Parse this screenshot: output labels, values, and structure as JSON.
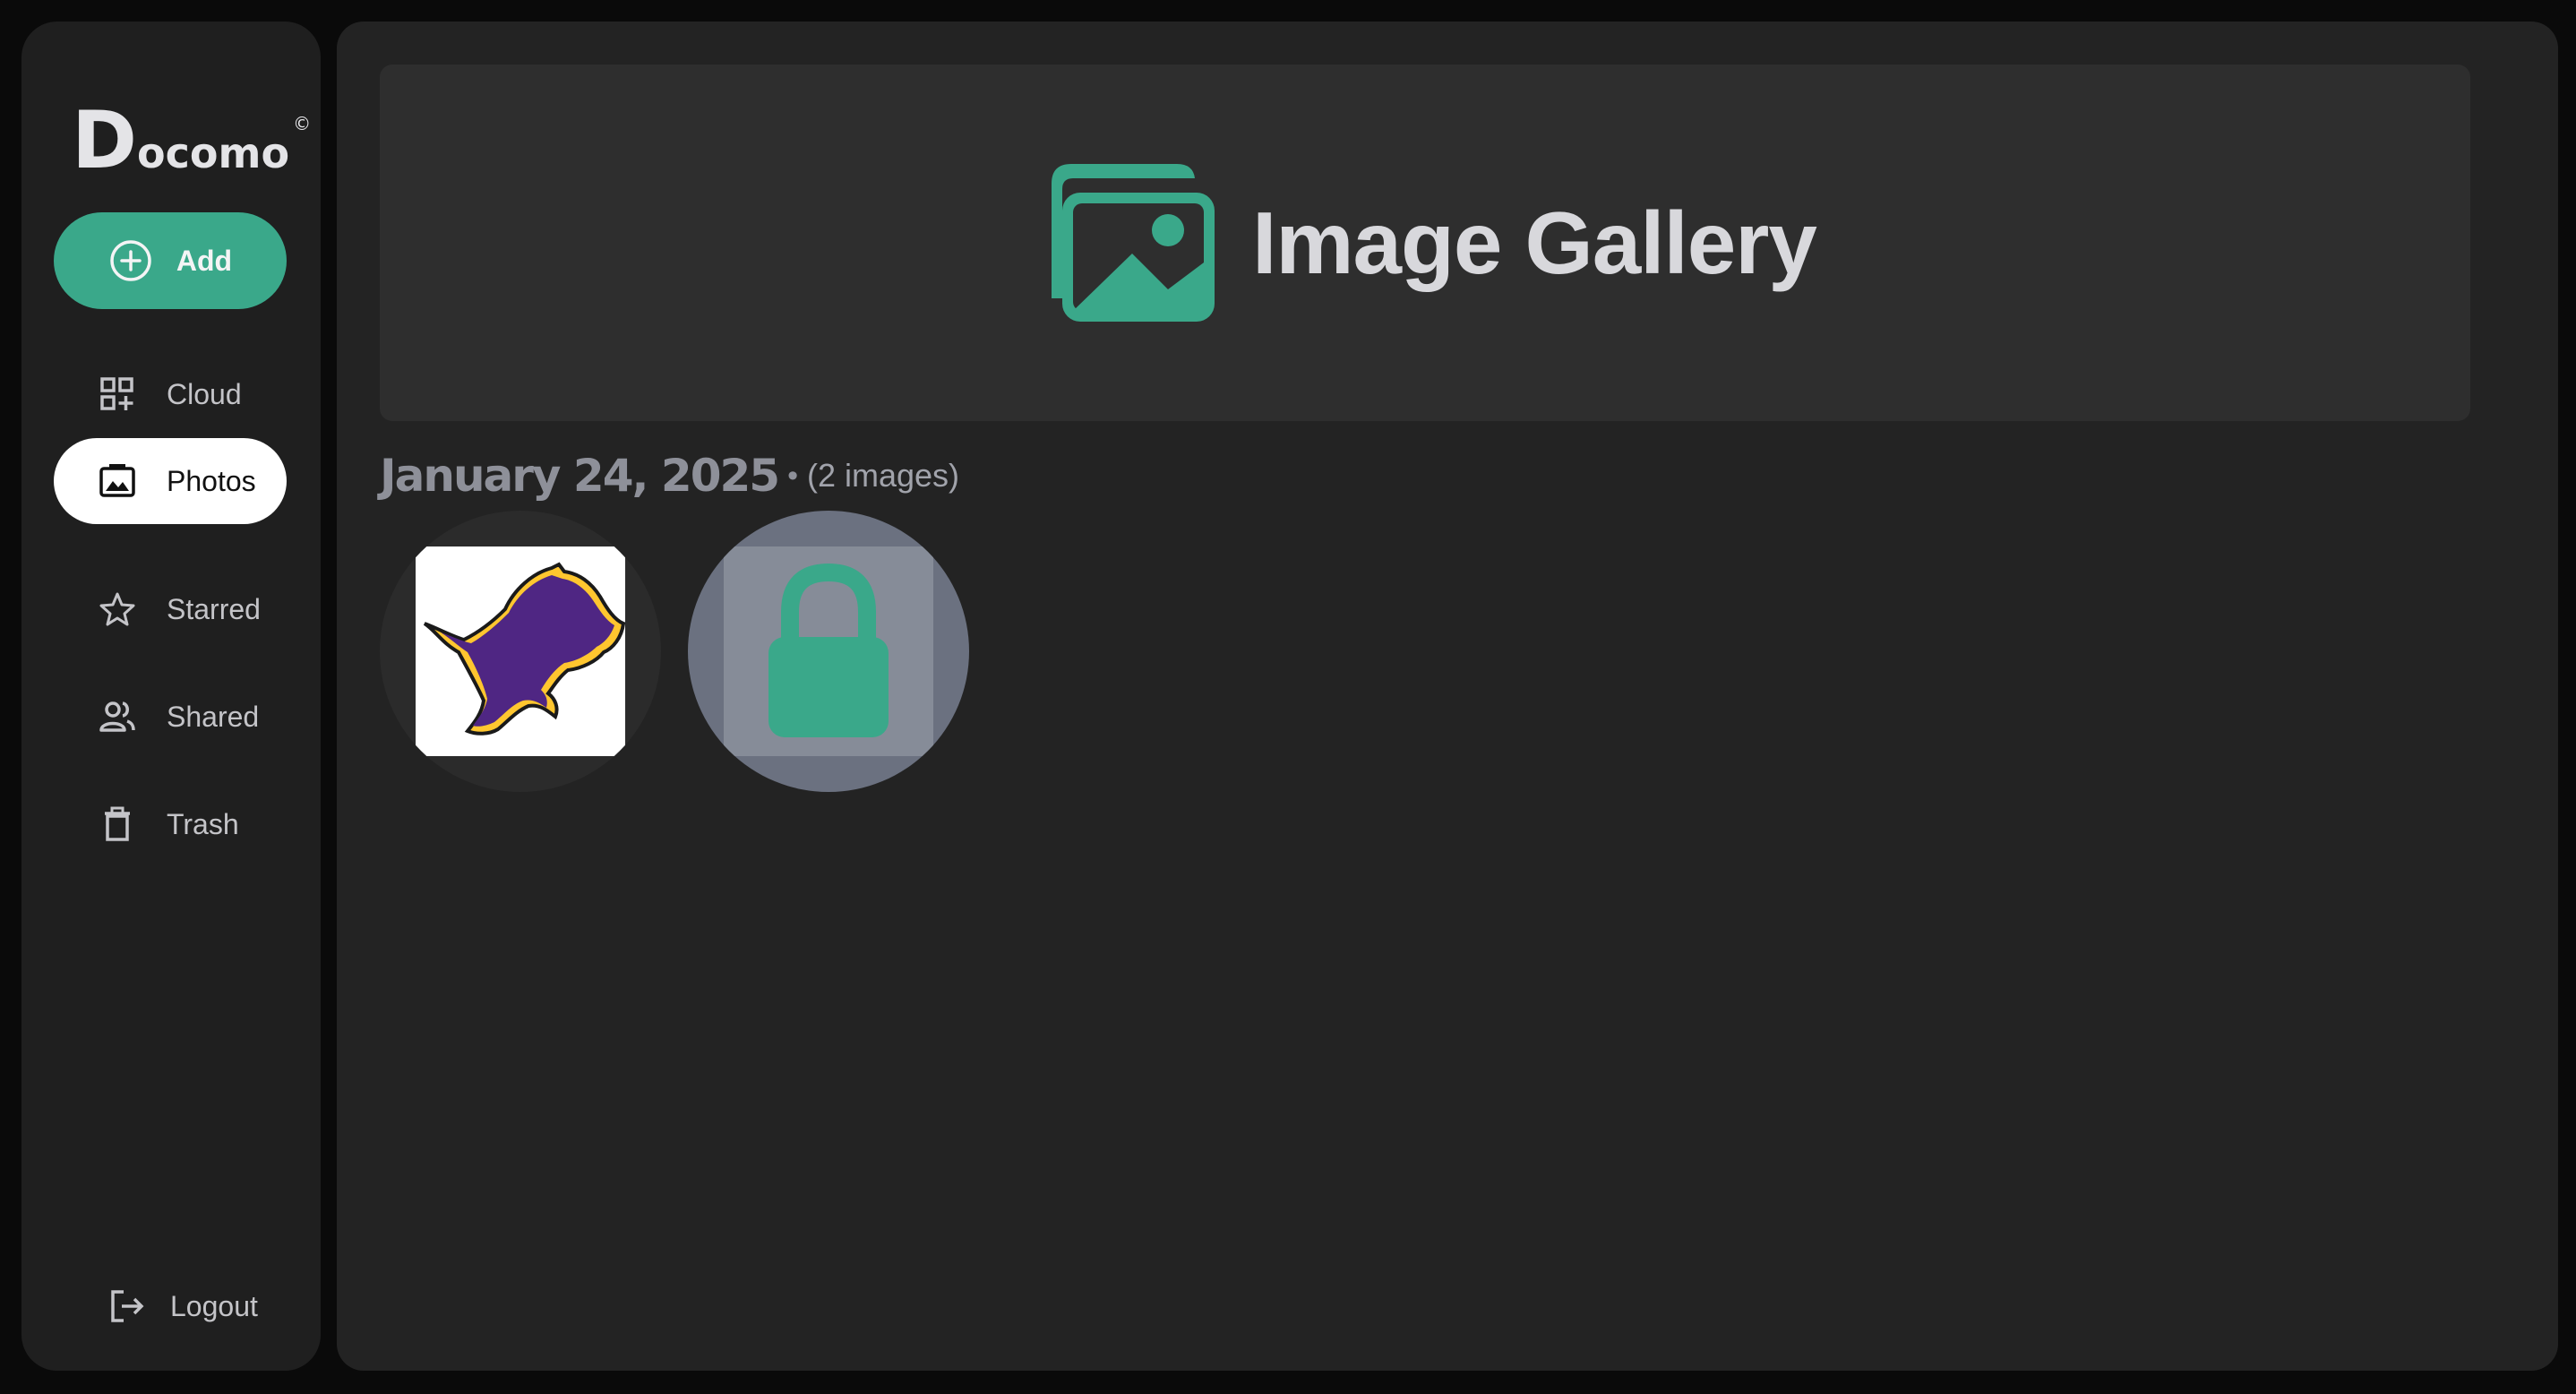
{
  "logo": {
    "initial": "D",
    "rest": "ocomo",
    "mark": "©"
  },
  "sidebar": {
    "add_label": "Add",
    "items": [
      {
        "label": "Cloud",
        "icon": "grid-plus-icon"
      },
      {
        "label": "Photos",
        "icon": "photo-icon"
      },
      {
        "label": "Starred",
        "icon": "star-icon"
      },
      {
        "label": "Shared",
        "icon": "people-icon"
      },
      {
        "label": "Trash",
        "icon": "trash-icon"
      }
    ],
    "active": "Photos",
    "logout_label": "Logout"
  },
  "banner": {
    "title": "Image Gallery",
    "icon": "image-gallery-icon"
  },
  "gallery": {
    "groups": [
      {
        "date": "January 24, 2025",
        "separator": "•",
        "count": "(2 images)",
        "images": [
          {
            "icon": "lion-logo-image",
            "locked": false
          },
          {
            "icon": "lock-icon",
            "locked": true
          }
        ]
      }
    ]
  },
  "colors": {
    "accent": "#3aa88a",
    "sidebar_bg": "#1f1f1f",
    "main_bg": "#232323",
    "lion_purple": "#4f2683",
    "lion_gold": "#ffc62f"
  }
}
